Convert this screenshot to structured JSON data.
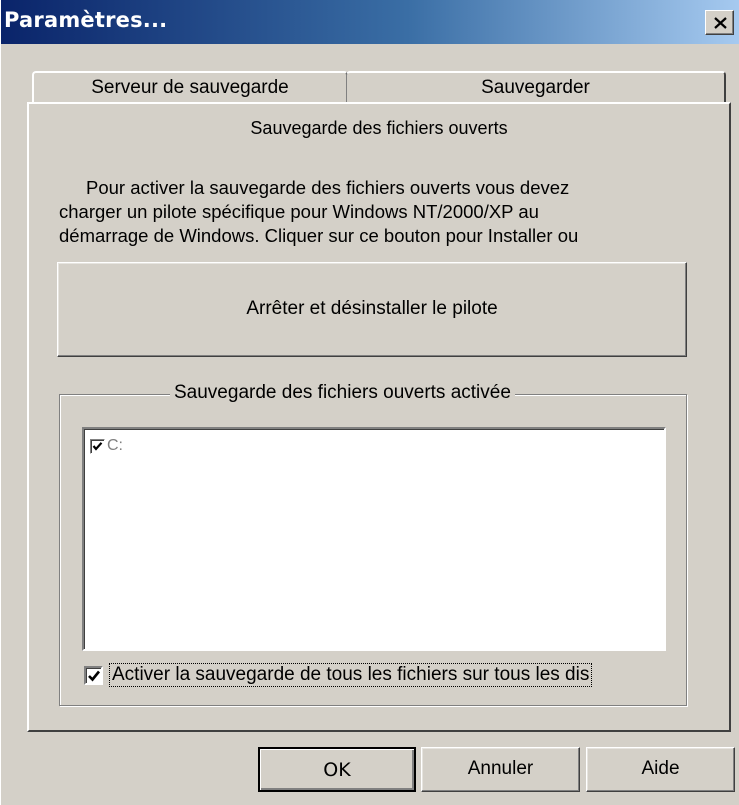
{
  "window": {
    "title": "Paramètres..."
  },
  "tabs": [
    {
      "label": "Serveur de sauvegarde"
    },
    {
      "label": "Sauvegarder"
    }
  ],
  "panel": {
    "title": "Sauvegarde des fichiers ouverts",
    "description_lines": [
      "Pour activer la sauvegarde des fichiers ouverts vous devez",
      "charger un pilote spécifique pour Windows NT/2000/XP au",
      "démarrage de Windows. Cliquer sur ce bouton pour Installer ou"
    ],
    "driver_button": "Arrêter et désinstaller le pilote",
    "group": {
      "legend": "Sauvegarde des fichiers ouverts activée",
      "drives": [
        {
          "label": "C:",
          "checked": true
        }
      ],
      "all_disks_label": "Activer la sauvegarde de tous les fichiers sur tous les dis",
      "all_disks_checked": true
    }
  },
  "buttons": {
    "ok": "OK",
    "cancel": "Annuler",
    "help": "Aide"
  },
  "colors": {
    "face": "#d4d0c8",
    "title_start": "#0a246a",
    "title_end": "#a6caf0"
  }
}
